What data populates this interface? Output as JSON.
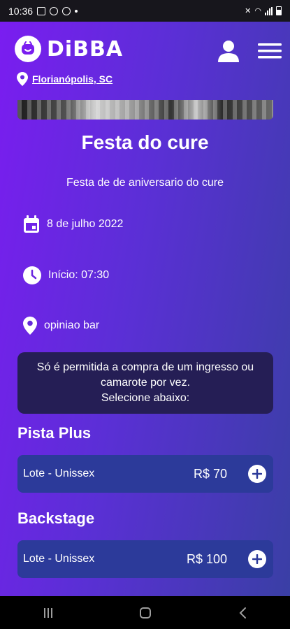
{
  "status_bar": {
    "time": "10:36"
  },
  "header": {
    "brand": "DiBBA",
    "location": "Florianópolis, SC"
  },
  "event": {
    "title": "Festa do cure",
    "description": "Festa de de aniversario do cure",
    "date": "8 de julho 2022",
    "start_time": "Início: 07:30",
    "venue": "opiniao bar"
  },
  "notice": {
    "line1": "Só é permitida a compra de um ingresso ou",
    "line2": "camarote por vez.",
    "line3": "Selecione abaixo:"
  },
  "sections": [
    {
      "title": "Pista Plus",
      "ticket": {
        "label": "Lote - Unissex",
        "price": "R$ 70"
      }
    },
    {
      "title": "Backstage",
      "ticket": {
        "label": "Lote - Unissex",
        "price": "R$ 100"
      }
    }
  ],
  "colors": {
    "gradient_start": "#7a1df0",
    "gradient_end": "#3a3fa5",
    "notice_bg": "#251e55",
    "ticket_bg": "#2c3a9a"
  },
  "icons": [
    "logo-icon",
    "user-icon",
    "menu-icon",
    "location-pin-icon",
    "calendar-icon",
    "clock-icon",
    "add-circle-icon"
  ]
}
